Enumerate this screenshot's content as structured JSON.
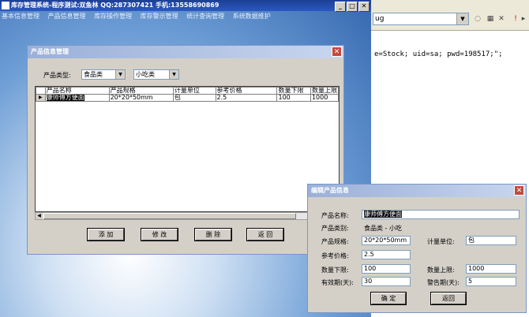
{
  "ide": {
    "combo_value": "ug",
    "code_line": "e=Stock; uid=sa; pwd=198517;\";"
  },
  "main": {
    "title": "库存管理系统-程序测试:双鱼林 QQ:287307421 手机:13558690869",
    "menu": [
      "基本信息管理",
      "产品信息管理",
      "库存操作管理",
      "库存警示管理",
      "统计查询管理",
      "系统数据维护"
    ]
  },
  "product_window": {
    "title": "产品信息管理",
    "type_label": "产品类型:",
    "category": "食品类",
    "subcategory": "小吃类",
    "columns": [
      "产品名称",
      "产品规格",
      "计量单位",
      "参考价格",
      "数量下限",
      "数量上限"
    ],
    "rows": [
      [
        "康师傅方便面",
        "20*20*50mm",
        "包",
        "2.5",
        "100",
        "1000"
      ]
    ],
    "buttons": {
      "add": "添 加",
      "edit": "修 改",
      "delete": "删 除",
      "back": "返 回"
    }
  },
  "edit_window": {
    "title": "编辑产品信息",
    "name_label": "产品名称:",
    "name_value": "康师傅方便面",
    "category_label": "产品类别:",
    "category_value": "食品类 - 小吃",
    "spec_label": "产品规格:",
    "spec_value": "20*20*50mm",
    "unit_label": "计量单位:",
    "unit_value": "包",
    "price_label": "参考价格:",
    "price_value": "2.5",
    "min_label": "数量下限:",
    "min_value": "100",
    "max_label": "数量上限:",
    "max_value": "1000",
    "valid_label": "有效期(天):",
    "valid_value": "30",
    "warn_label": "警告期(天):",
    "warn_value": "5",
    "ok_label": "确 定",
    "back_label": "返回"
  }
}
